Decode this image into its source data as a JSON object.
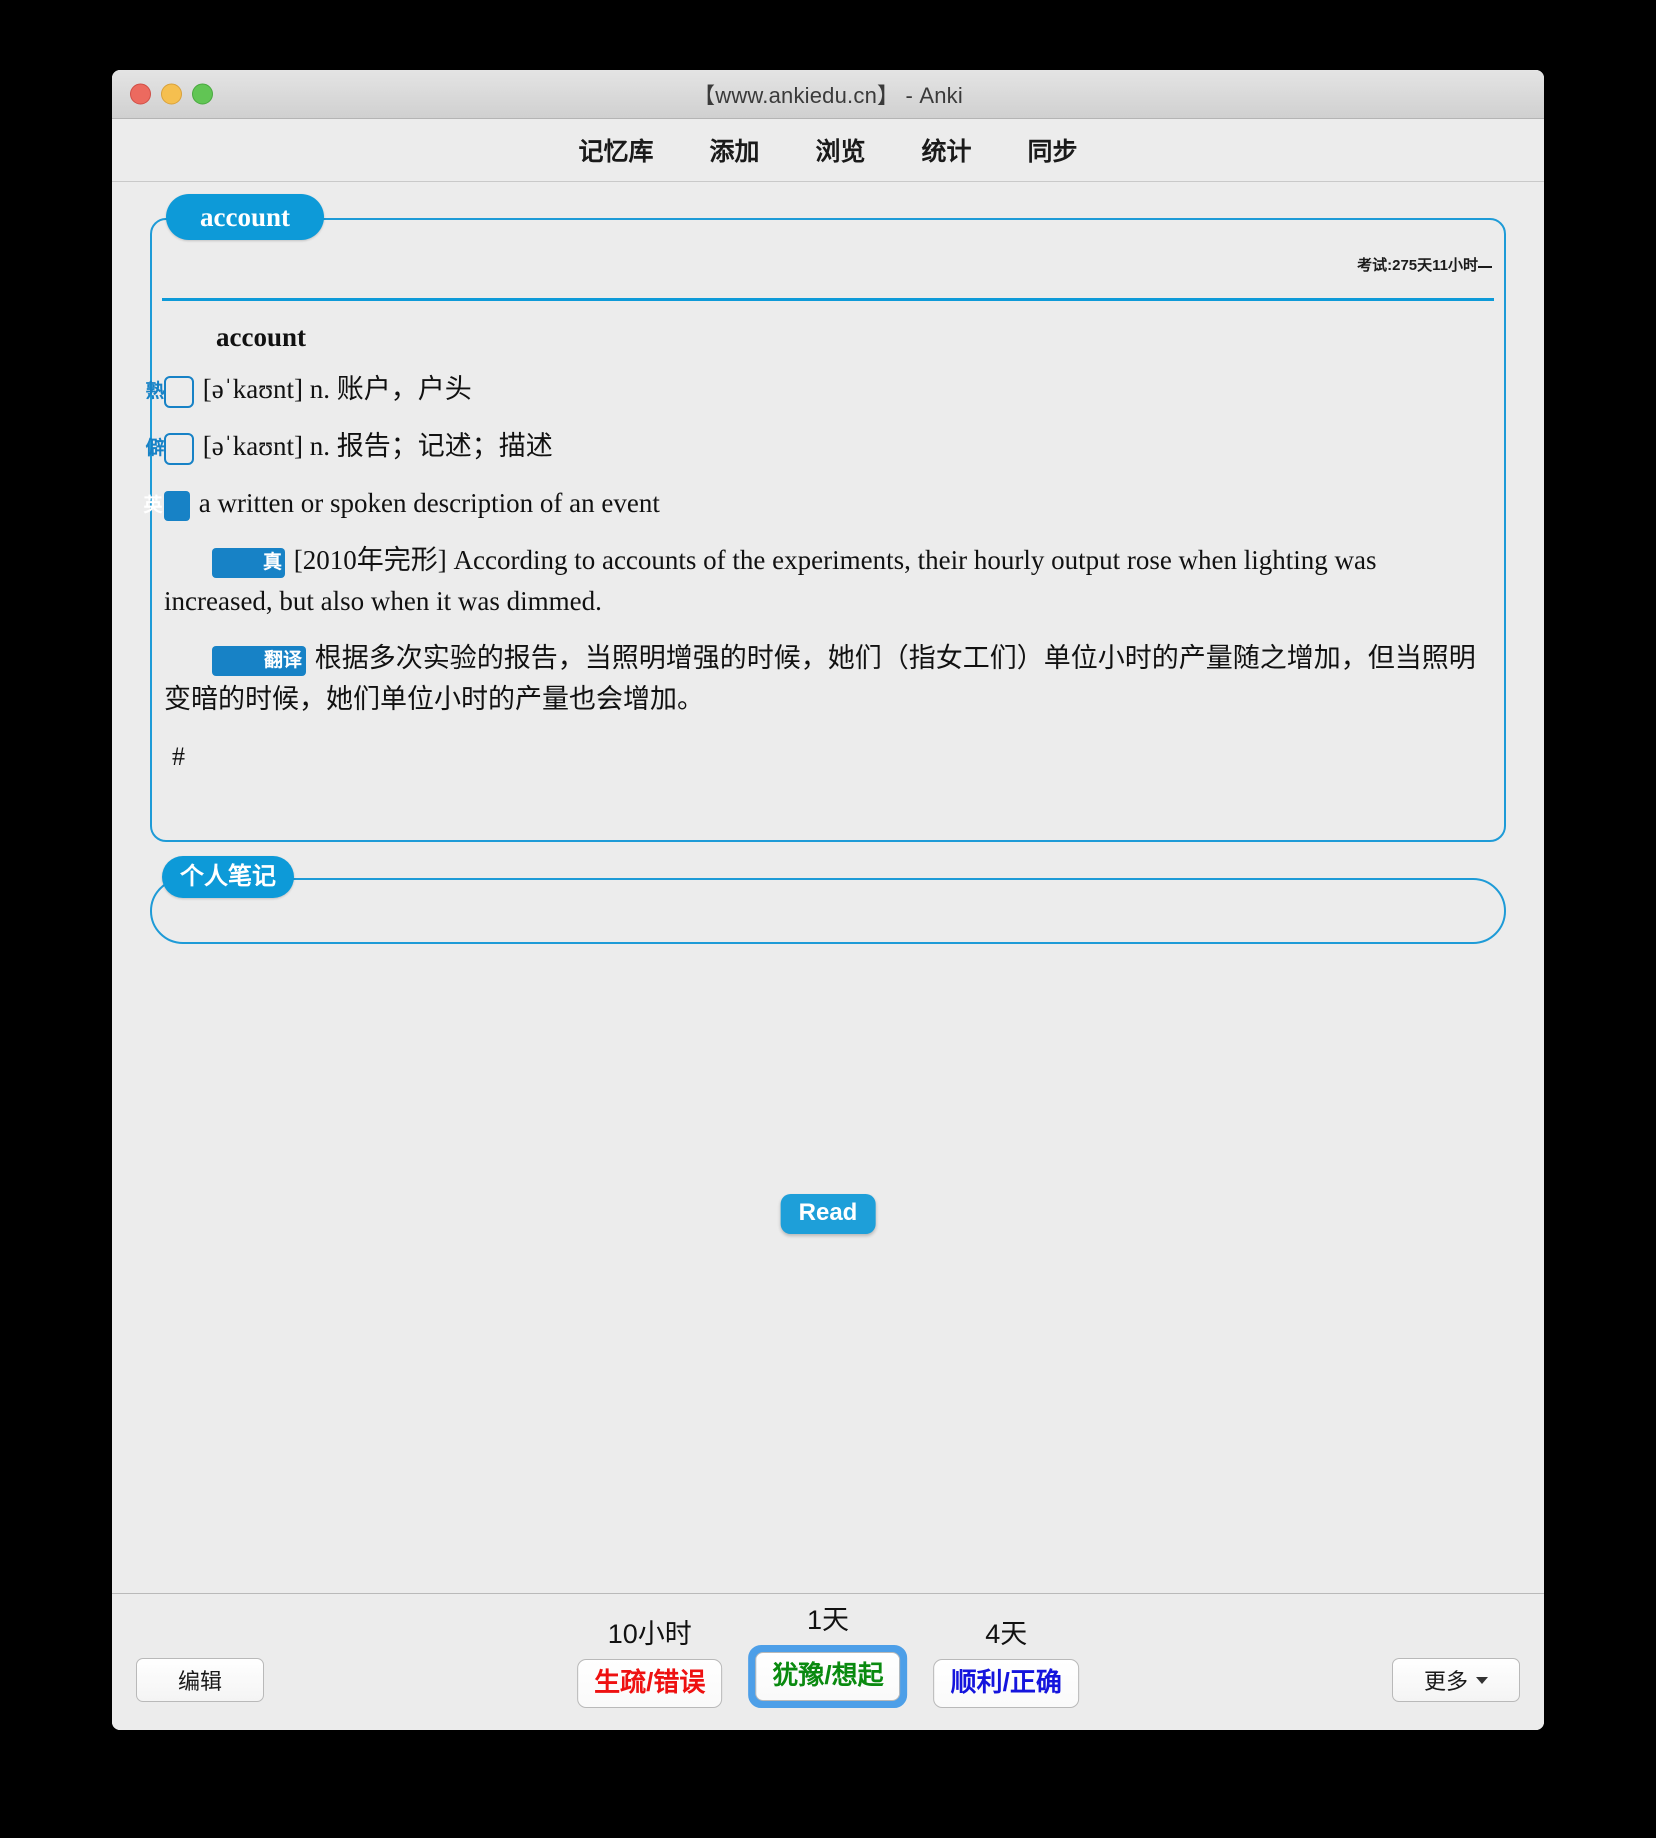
{
  "window": {
    "title": "【www.ankiedu.cn】 - Anki",
    "traffic_lights": [
      "close-red",
      "minimize-yellow",
      "zoom-green"
    ]
  },
  "navbar": {
    "items": [
      {
        "label": "记忆库",
        "name": "nav-decks"
      },
      {
        "label": "添加",
        "name": "nav-add"
      },
      {
        "label": "浏览",
        "name": "nav-browse"
      },
      {
        "label": "统计",
        "name": "nav-stats"
      },
      {
        "label": "同步",
        "name": "nav-sync"
      }
    ]
  },
  "card": {
    "field_legend": "account",
    "exam_countdown": "考试:275天11小时",
    "headword": "account",
    "entries": [
      {
        "badge": "熟",
        "badge_style": "outline",
        "text": "[əˈkaʊnt] n. 账户，户头"
      },
      {
        "badge": "僻",
        "badge_style": "outline",
        "text": "[əˈkaʊnt] n. 报告；记述；描述"
      },
      {
        "badge": "英",
        "badge_style": "solid",
        "text": "a written or spoken description of an event"
      },
      {
        "badge": "真",
        "badge_style": "solid",
        "text": "[2010年完形] According to accounts of the experiments, their hourly output rose when lighting was increased, but also when it was dimmed."
      },
      {
        "badge": "翻译",
        "badge_style": "solid-wide",
        "text": "根据多次实验的报告，当照明增强的时候，她们（指女工们）单位小时的产量随之增加，但当照明变暗的时候，她们单位小时的产量也会增加。"
      }
    ],
    "trailing_marker": "#"
  },
  "notes": {
    "legend": "个人笔记",
    "value": ""
  },
  "read_button": {
    "label": "Read"
  },
  "bottom_bar": {
    "edit_label": "编辑",
    "more_label": "更多",
    "answers": [
      {
        "interval": "10小时",
        "label": "生疏/错误",
        "tone": "again",
        "focused": false
      },
      {
        "interval": "1天",
        "label": "犹豫/想起",
        "tone": "hard",
        "focused": true
      },
      {
        "interval": "4天",
        "label": "顺利/正确",
        "tone": "good",
        "focused": false
      }
    ]
  },
  "colors": {
    "accent_blue": "#0d9ad8",
    "badge_blue": "#1782c6",
    "again_red": "#ee1111",
    "hard_green": "#0a8a10",
    "good_blue": "#1414dd",
    "window_bg": "#ececec",
    "focus_ring": "#4d9fe8"
  }
}
